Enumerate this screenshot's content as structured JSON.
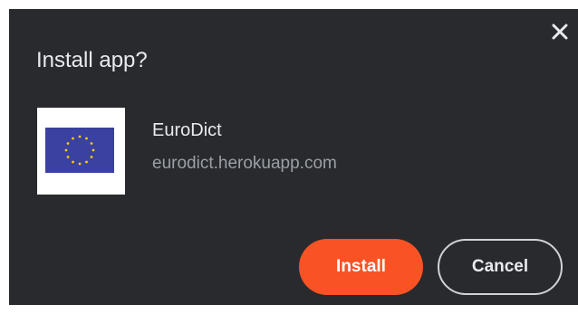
{
  "dialog": {
    "title": "Install app?",
    "close_icon": "close-icon"
  },
  "app": {
    "icon": "eu-flag-icon",
    "name": "EuroDict",
    "origin": "eurodict.herokuapp.com"
  },
  "buttons": {
    "install_label": "Install",
    "cancel_label": "Cancel"
  },
  "colors": {
    "dialog_background": "#292a2d",
    "text_primary": "#e8eaed",
    "text_secondary": "#9aa0a6",
    "install_button": "#f95325",
    "eu_blue": "#3a41a0",
    "eu_gold": "#ffcc00"
  }
}
